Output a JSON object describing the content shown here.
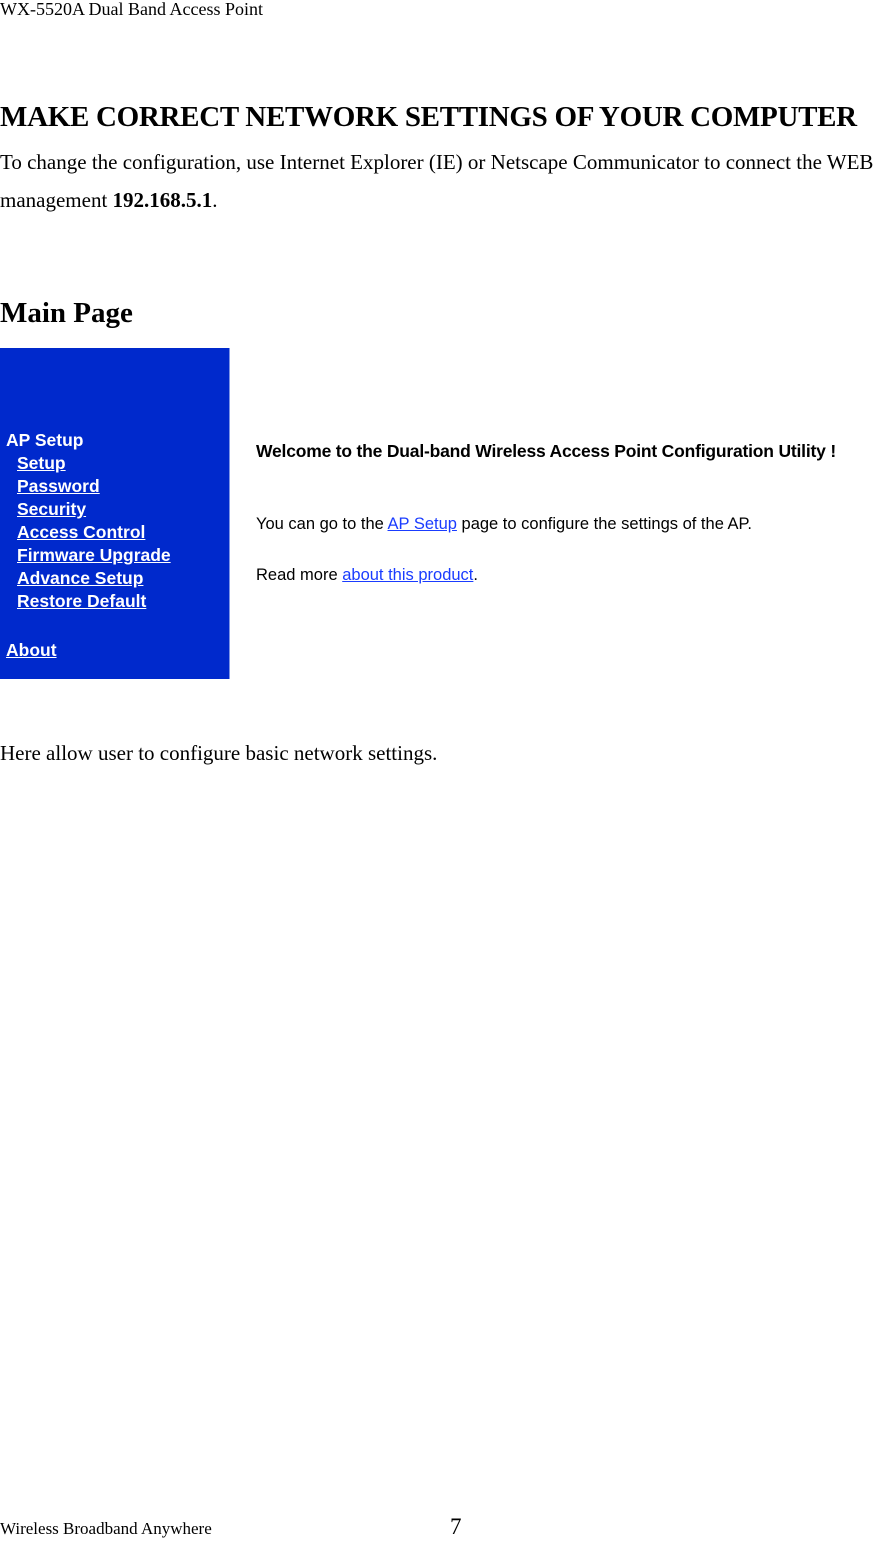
{
  "header": {
    "title": "WX-5520A Dual Band Access Point"
  },
  "section": {
    "heading": "MAKE CORRECT NETWORK SETTINGS OF YOUR COMPUTER",
    "intro_text": "To change the configuration, use Internet Explorer (IE) or Netscape Communicator to connect the WEB management ",
    "ip_address": "192.168.5.1",
    "intro_end": "."
  },
  "main_page": {
    "heading": "Main Page"
  },
  "screenshot": {
    "colors": {
      "sidebar_bg": "#0029CC",
      "sidebar_text": "#FFFFFF",
      "link": "#1A3CFF"
    },
    "sidebar": {
      "group_title": "AP Setup",
      "items": [
        {
          "label": "Setup"
        },
        {
          "label": "Password"
        },
        {
          "label": "Security"
        },
        {
          "label": "Access Control"
        },
        {
          "label": "Firmware Upgrade"
        },
        {
          "label": "Advance Setup"
        },
        {
          "label": "Restore Default"
        }
      ],
      "about": "About"
    },
    "content": {
      "welcome": "Welcome to the Dual-band Wireless Access Point Configuration Utility !",
      "line1_prefix": "You can go to the ",
      "line1_link": "AP Setup",
      "line1_suffix": " page to configure the settings of the AP.",
      "line2_prefix": "Read more ",
      "line2_link": "about this product",
      "line2_suffix": "."
    }
  },
  "description": "Here allow user to configure basic network settings.",
  "footer": {
    "left": "Wireless Broadband Anywhere",
    "page_number": "7"
  }
}
